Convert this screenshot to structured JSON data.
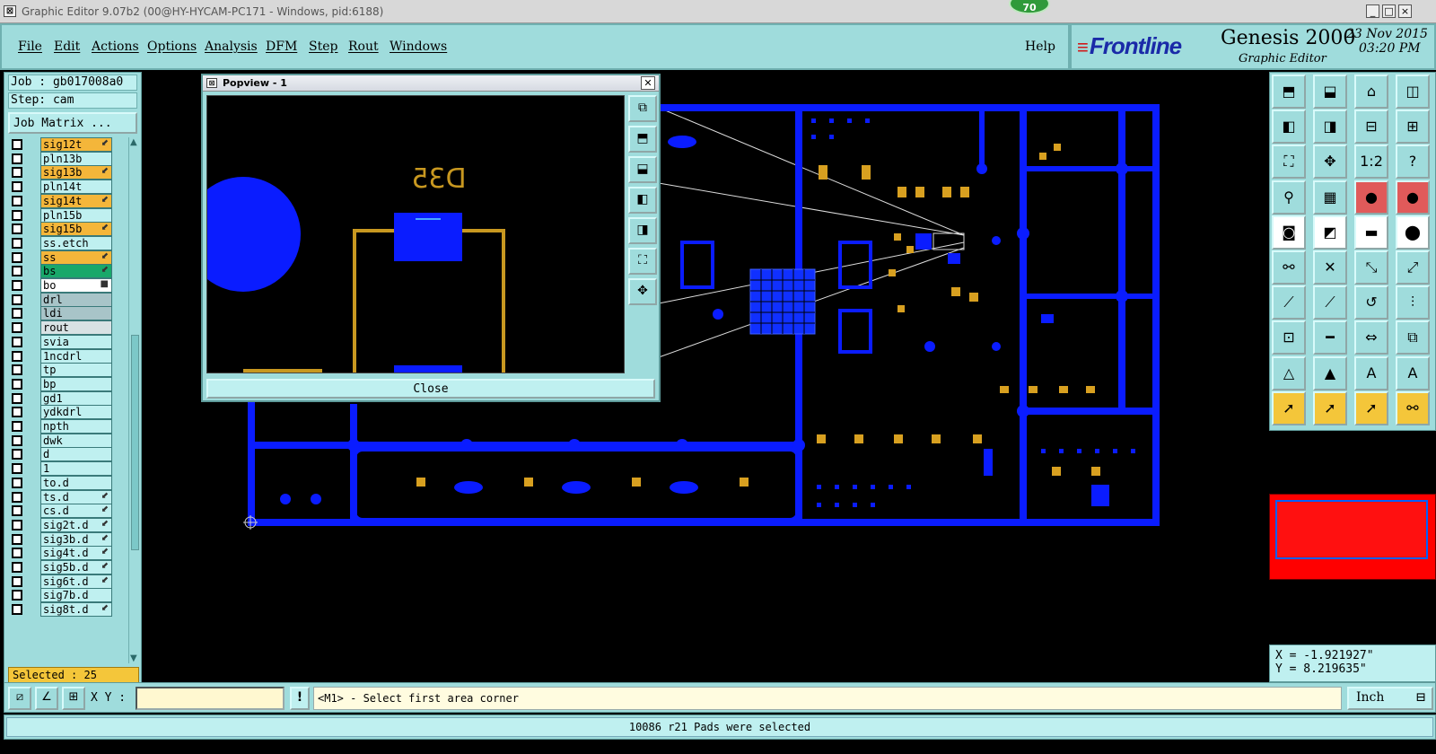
{
  "window": {
    "title": "Graphic Editor 9.07b2 (00@HY-HYCAM-PC171 - Windows, pid:6188)",
    "badge": "70",
    "controls": [
      "_",
      "□",
      "×"
    ]
  },
  "menu": {
    "items": [
      "File",
      "Edit",
      "Actions",
      "Options",
      "Analysis",
      "DFM",
      "Step",
      "Rout",
      "Windows"
    ],
    "help": "Help"
  },
  "brand": {
    "logo": "Frontline",
    "product": "Genesis 2000",
    "subtitle": "Graphic Editor",
    "date": "23 Nov 2015",
    "time": "03:20 PM"
  },
  "job": {
    "job_label": "Job : gb017008a0",
    "step_label": "Step: cam",
    "matrix_button": "Job Matrix ..."
  },
  "layers": [
    {
      "name": "sig12t",
      "style": "orange",
      "sym": "⬋"
    },
    {
      "name": "pln13b",
      "style": "",
      "sym": ""
    },
    {
      "name": "sig13b",
      "style": "orange",
      "sym": "⬋"
    },
    {
      "name": "pln14t",
      "style": "",
      "sym": ""
    },
    {
      "name": "sig14t",
      "style": "orange",
      "sym": "⬋"
    },
    {
      "name": "pln15b",
      "style": "",
      "sym": ""
    },
    {
      "name": "sig15b",
      "style": "orange",
      "sym": "⬋"
    },
    {
      "name": "ss.etch",
      "style": "",
      "sym": ""
    },
    {
      "name": "ss",
      "style": "orange",
      "sym": "⬋"
    },
    {
      "name": "bs",
      "style": "green",
      "sym": "⬋"
    },
    {
      "name": "bo",
      "style": "white",
      "sym": "■"
    },
    {
      "name": "drl",
      "style": "gray",
      "sym": ""
    },
    {
      "name": "ldi",
      "style": "gray",
      "sym": ""
    },
    {
      "name": "rout",
      "style": "lgray",
      "sym": ""
    },
    {
      "name": "svia",
      "style": "",
      "sym": ""
    },
    {
      "name": "1ncdrl",
      "style": "",
      "sym": ""
    },
    {
      "name": "tp",
      "style": "",
      "sym": ""
    },
    {
      "name": "bp",
      "style": "",
      "sym": ""
    },
    {
      "name": "gd1",
      "style": "",
      "sym": ""
    },
    {
      "name": "ydkdrl",
      "style": "",
      "sym": ""
    },
    {
      "name": "npth",
      "style": "",
      "sym": ""
    },
    {
      "name": "dwk",
      "style": "",
      "sym": ""
    },
    {
      "name": "d",
      "style": "",
      "sym": ""
    },
    {
      "name": "1",
      "style": "",
      "sym": ""
    },
    {
      "name": "to.d",
      "style": "",
      "sym": ""
    },
    {
      "name": "ts.d",
      "style": "",
      "sym": "⬋"
    },
    {
      "name": "cs.d",
      "style": "",
      "sym": "⬋"
    },
    {
      "name": "sig2t.d",
      "style": "",
      "sym": "⬋"
    },
    {
      "name": "sig3b.d",
      "style": "",
      "sym": "⬋"
    },
    {
      "name": "sig4t.d",
      "style": "",
      "sym": "⬋"
    },
    {
      "name": "sig5b.d",
      "style": "",
      "sym": "⬋"
    },
    {
      "name": "sig6t.d",
      "style": "",
      "sym": "⬋"
    },
    {
      "name": "sig7b.d",
      "style": "",
      "sym": ""
    },
    {
      "name": "sig8t.d",
      "style": "",
      "sym": "⬋"
    }
  ],
  "selected": "Selected : 25",
  "popview": {
    "title": "Popview - 1",
    "close_x": "✕",
    "close_button": "Close",
    "refdes": "D35"
  },
  "coords": {
    "x": "X = -1.921927\"",
    "y": "Y = 8.219635\""
  },
  "cmd": {
    "xy_label": "X Y :",
    "xy_value": "",
    "excl": "!",
    "prompt": "<M1> - Select first area corner",
    "units": "Inch"
  },
  "status": "10086 r21 Pads were selected",
  "colors": {
    "panel": "#9fdcdc",
    "copper": "#0a1cff",
    "pads": "#d8a020",
    "highlight": "#ff0000"
  },
  "tool_icons": [
    "layer-up-icon",
    "layer-down-icon",
    "home-icon",
    "zoom-window-icon",
    "pan-left-icon",
    "pan-right-icon",
    "zoom-1-icon",
    "snap-icon",
    "zoom-fit-icon",
    "zoom-center-icon",
    "scale-1-2-icon",
    "help-icon",
    "measure-icon",
    "grid-icon",
    "traffic-red-icon",
    "traffic-green-icon",
    "camera-icon",
    "select-red-icon",
    "ruler-icon",
    "circle-icon",
    "connect-icon",
    "cross-icon",
    "move-icon",
    "rotate-icon",
    "line-red-icon",
    "line-icon",
    "undo-icon",
    "flip-icon",
    "pad-icon",
    "minus-icon",
    "mirror-icon",
    "copy-icon",
    "triangle-icon",
    "arrow-up-icon",
    "a-letter-icon",
    "align-icon",
    "pointer-icon",
    "pointer-box-icon",
    "pointer-box2-icon",
    "net-icon"
  ]
}
